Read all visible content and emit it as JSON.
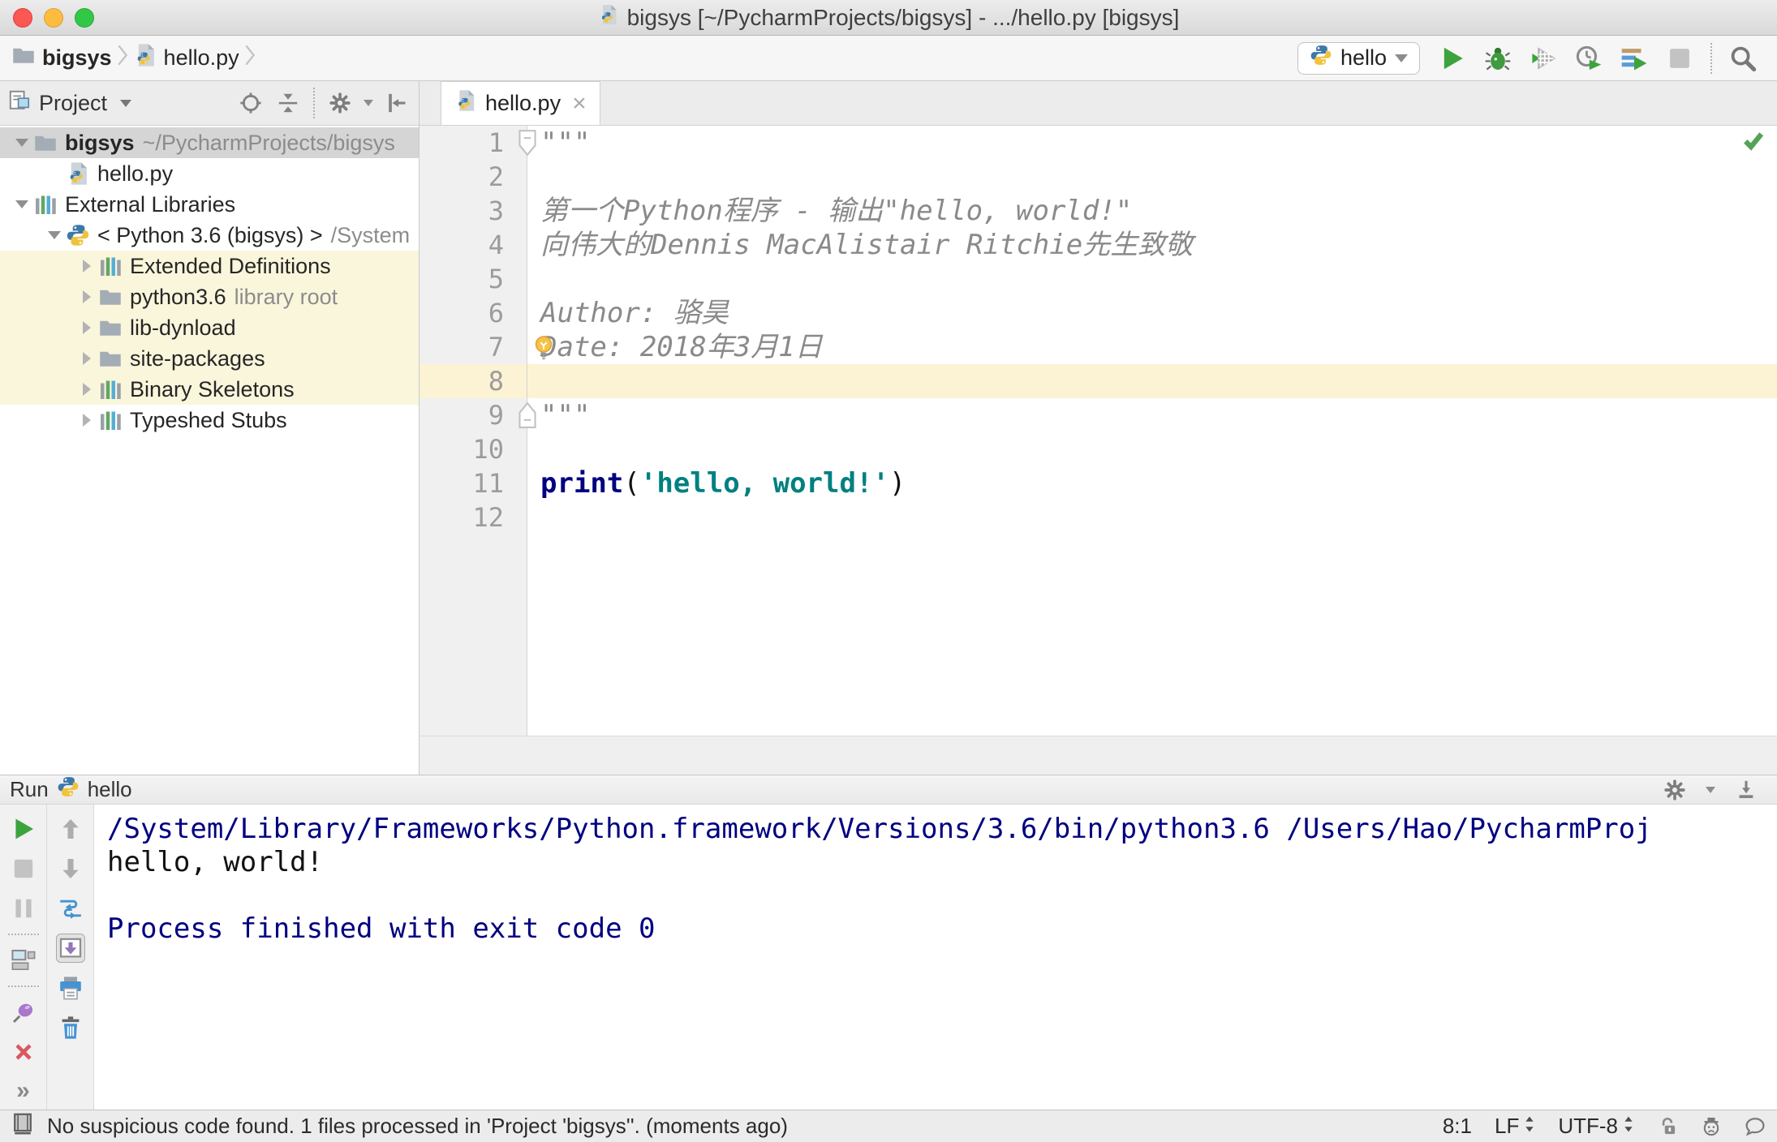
{
  "window": {
    "title": "bigsys [~/PycharmProjects/bigsys] - .../hello.py [bigsys]"
  },
  "navbar": {
    "breadcrumbs": [
      {
        "label": "bigsys",
        "icon": "folder",
        "bold": true
      },
      {
        "label": "hello.py",
        "icon": "python-file",
        "bold": false
      }
    ],
    "run_config": {
      "icon": "python",
      "label": "hello"
    },
    "actions": [
      "run",
      "debug",
      "run-with-coverage",
      "profile",
      "concurrency-diagram",
      "stop",
      "divider",
      "search-everywhere"
    ]
  },
  "project_panel": {
    "title": "Project",
    "header_actions": [
      "locate",
      "collapse-all",
      "divider",
      "settings",
      "hide-panel"
    ],
    "tree": [
      {
        "level": 0,
        "expander": "open",
        "icon": "folder",
        "label": "bigsys",
        "bold": true,
        "hint": "~/PycharmProjects/bigsys",
        "selected": true
      },
      {
        "level": 1,
        "expander": "none",
        "icon": "python-file",
        "label": "hello.py"
      },
      {
        "level": 0,
        "expander": "open",
        "icon": "library",
        "label": "External Libraries"
      },
      {
        "level": 1,
        "expander": "open",
        "icon": "python",
        "label": "< Python 3.6 (bigsys) >",
        "hint": "/System"
      },
      {
        "level": 2,
        "expander": "closed",
        "icon": "library",
        "label": "Extended Definitions",
        "highlighted": true
      },
      {
        "level": 2,
        "expander": "closed",
        "icon": "folder",
        "label": "python3.6",
        "hint": "library root",
        "highlighted": true
      },
      {
        "level": 2,
        "expander": "closed",
        "icon": "folder",
        "label": "lib-dynload",
        "highlighted": true
      },
      {
        "level": 2,
        "expander": "closed",
        "icon": "folder",
        "label": "site-packages",
        "highlighted": true
      },
      {
        "level": 2,
        "expander": "closed",
        "icon": "library",
        "label": "Binary Skeletons",
        "highlighted": true
      },
      {
        "level": 2,
        "expander": "closed",
        "icon": "library",
        "label": "Typeshed Stubs"
      }
    ]
  },
  "editor": {
    "tab": {
      "icon": "python-file",
      "label": "hello.py",
      "close": "×"
    },
    "inspection_status": "no-problems",
    "lines": [
      {
        "num": 1,
        "fold": "start",
        "segments": [
          {
            "c": "doc",
            "t": "\"\"\""
          }
        ]
      },
      {
        "num": 2,
        "segments": []
      },
      {
        "num": 3,
        "segments": [
          {
            "c": "doc",
            "t": "第一个Python程序 - 输出\"hello, world!\""
          }
        ]
      },
      {
        "num": 4,
        "segments": [
          {
            "c": "doc",
            "t": "向伟大的Dennis MacAlistair Ritchie先生致敬"
          }
        ]
      },
      {
        "num": 5,
        "segments": []
      },
      {
        "num": 6,
        "segments": [
          {
            "c": "doc",
            "t": "Author: 骆昊"
          }
        ]
      },
      {
        "num": 7,
        "bulb": true,
        "segments": [
          {
            "c": "doc",
            "t": "Date: 2018年3月1日"
          }
        ]
      },
      {
        "num": 8,
        "current": true,
        "segments": []
      },
      {
        "num": 9,
        "fold": "end",
        "segments": [
          {
            "c": "doc",
            "t": "\"\"\""
          }
        ]
      },
      {
        "num": 10,
        "segments": []
      },
      {
        "num": 11,
        "segments": [
          {
            "c": "kw",
            "t": "print"
          },
          {
            "c": "plain",
            "t": "("
          },
          {
            "c": "str",
            "t": "'hello, world!'"
          },
          {
            "c": "plain",
            "t": ")"
          }
        ]
      },
      {
        "num": 12,
        "segments": []
      }
    ]
  },
  "run_panel": {
    "title": "Run",
    "config": {
      "icon": "python",
      "label": "hello"
    },
    "header_actions": [
      "settings",
      "hide-panel-down"
    ],
    "toolbar_left": [
      "rerun",
      "stop-disabled",
      "pause-disabled",
      "divider",
      "restore-layout",
      "divider",
      "pin",
      "close",
      "more"
    ],
    "toolbar_right": [
      "up-stack-trace",
      "down-stack-trace",
      "soft-wrap",
      "scroll-to-end-selected",
      "print",
      "clear-all"
    ],
    "more_label": "»",
    "console": [
      {
        "c": "path",
        "t": "/System/Library/Frameworks/Python.framework/Versions/3.6/bin/python3.6 /Users/Hao/PycharmProj"
      },
      {
        "c": "plain",
        "t": "hello, world!"
      },
      {
        "c": "plain",
        "t": ""
      },
      {
        "c": "path",
        "t": "Process finished with exit code 0"
      }
    ]
  },
  "status_bar": {
    "message": "No suspicious code found. 1 files processed in 'Project 'bigsys''. (moments ago)",
    "caret_position": "8:1",
    "line_separator": "LF",
    "encoding": "UTF-8",
    "right_icons": [
      "unlock",
      "hector-inspector",
      "feedback-bubble"
    ]
  },
  "colors": {
    "keyword": "#000080",
    "string": "#008080",
    "docstring": "#8a8a8a",
    "console_path": "#000080",
    "accent_green": "#3da33d",
    "tree_selection": "#d5d5d5",
    "library_scope_highlight": "#faf6dc",
    "current_line": "#fbf3d3"
  }
}
